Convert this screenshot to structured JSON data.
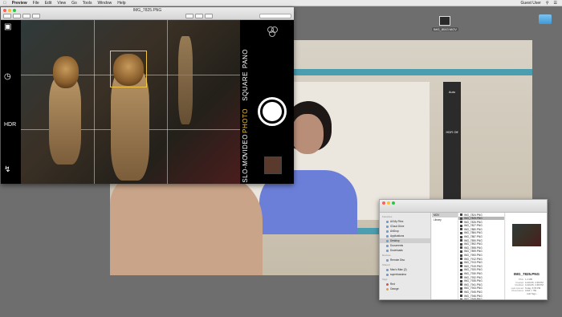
{
  "menubar": {
    "app": "Preview",
    "items": [
      "File",
      "Edit",
      "View",
      "Go",
      "Tools",
      "Window",
      "Help"
    ],
    "user": "Guest User"
  },
  "desktop": {
    "icons": [
      {
        "label": "IMG_8043.MOV"
      },
      {
        "label": ""
      }
    ]
  },
  "preview_window": {
    "title": "IMG_7825.PNG",
    "camera": {
      "modes": [
        "PANO",
        "SQUARE",
        "PHOTO",
        "VIDEO",
        "SLO-MO",
        "TIME-LAPSE"
      ],
      "active_mode": "PHOTO",
      "hdr_label": "HDR",
      "left_icons": [
        "camera-switch-icon",
        "timer-icon",
        "hdr-icon",
        "flash-off-icon"
      ]
    }
  },
  "photo": {
    "phone_labels": {
      "top": "Auto",
      "middle": "HDR Off"
    }
  },
  "finder": {
    "title": "",
    "sidebar": {
      "favorites_header": "Favorites",
      "favorites": [
        "All My Files",
        "iCloud Drive",
        "AirDrop",
        "Applications",
        "Desktop",
        "Documents",
        "Downloads"
      ],
      "selected": "Desktop",
      "devices_header": "Devices",
      "devices": [
        "Remote Disc"
      ],
      "shared_header": "Shared",
      "shared": [
        "Mac's iMac (2)",
        "superbossima"
      ],
      "tags_header": "Tags",
      "tags": [
        "Red",
        "Orange"
      ]
    },
    "col1": [
      "MOV",
      "Library"
    ],
    "files": [
      "IMG_7824.PNG",
      "IMG_7825.PNG",
      "IMG_7826.PNG",
      "IMG_7827.PNG",
      "IMG_7880.PNG",
      "IMG_7884.PNG",
      "IMG_7887.PNG",
      "IMG_7890.PNG",
      "IMG_7892.PNG",
      "IMG_7898.PNG",
      "IMG_7899.PNG",
      "IMG_7900.PNG",
      "IMG_7912.PNG",
      "IMG_7913.PNG",
      "IMG_7919.PNG",
      "IMG_7920.PNG",
      "IMG_7930.PNG",
      "IMG_7932.PNG",
      "IMG_7935.PNG",
      "IMG_7941.PNG",
      "IMG_7943.PNG",
      "IMG_7945.PNG",
      "IMG_7946.PNG",
      "IMG_7948.PNG",
      "IMG_7949.PNG",
      "IMG_7951.PNG",
      "IMG_7955.PNG",
      "IMG_7960.PNG"
    ],
    "selected_file": "IMG_7825.PNG",
    "preview": {
      "name": "IMG_7825.PNG",
      "meta": [
        {
          "k": "PNG",
          "v": "1.2 MB"
        },
        {
          "k": "Created",
          "v": "11/16/15, 3:38 PM"
        },
        {
          "k": "Modified",
          "v": "11/16/15, 3:38 PM"
        },
        {
          "k": "Last opened",
          "v": "Today, 6:55 PM"
        },
        {
          "k": "Dimensions",
          "v": "1334 × 750"
        }
      ],
      "add_tags": "Add Tags..."
    }
  }
}
